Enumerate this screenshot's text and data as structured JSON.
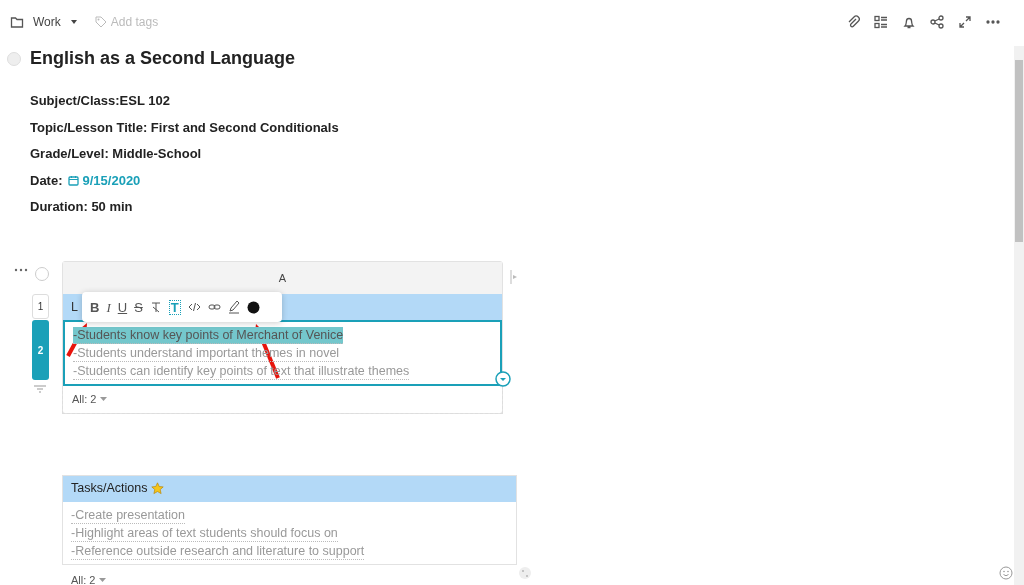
{
  "top_bar": {
    "folder": "Work",
    "tags_placeholder": "Add tags"
  },
  "title": "English as a Second Language",
  "fields": [
    {
      "kind": "text",
      "text": "Subject/Class:ESL 102"
    },
    {
      "kind": "text",
      "text": "Topic/Lesson Title: First and Second Conditionals"
    },
    {
      "kind": "text",
      "text": "Grade/Level: Middle-School"
    },
    {
      "kind": "date",
      "label": "Date:",
      "date": "9/15/2020"
    },
    {
      "kind": "text",
      "text": "Duration: 50 min"
    }
  ],
  "table": {
    "column": "A",
    "rows": [
      {
        "number": "1",
        "selected": false,
        "kind": "header",
        "lines": [
          {
            "text": "L",
            "highlighted": false
          }
        ]
      },
      {
        "number": "2",
        "selected": true,
        "kind": "body",
        "lines": [
          {
            "text": "-Students know key points of Merchant of Venice",
            "highlighted": true
          },
          {
            "text": "-Students understand important themes in novel",
            "highlighted": false
          },
          {
            "text": "-Students can identify key points of text that illustrate themes",
            "highlighted": false
          }
        ]
      }
    ],
    "footer": "All: 2"
  },
  "format_toolbar": {
    "letters": [
      "B",
      "I",
      "U",
      "S"
    ],
    "text_style": "T"
  },
  "tasks_card": {
    "title": "Tasks/Actions",
    "lines": [
      "-Create presentation",
      "-Highlight areas of text students should focus on",
      "-Reference outside research and literature to support"
    ],
    "footer": "All: 2"
  }
}
